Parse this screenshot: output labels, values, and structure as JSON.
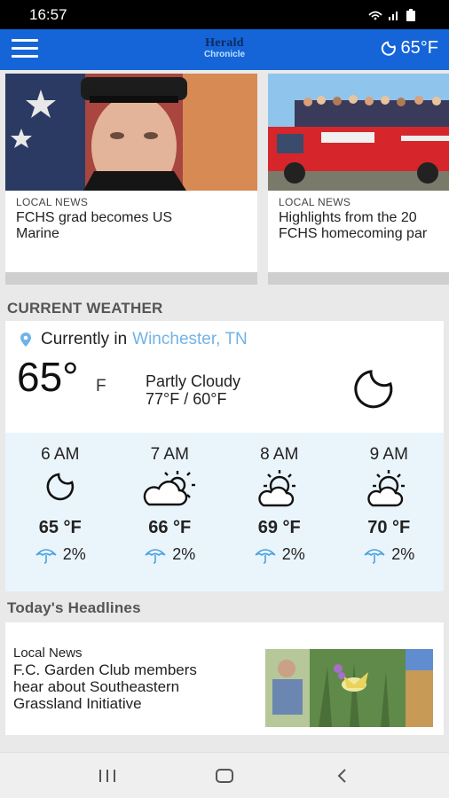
{
  "status_bar": {
    "time": "16:57"
  },
  "app_bar": {
    "logo_line1": "Herald",
    "logo_line2": "Chronicle",
    "temperature": "65°F"
  },
  "top_stories": [
    {
      "kicker": "LOCAL NEWS",
      "title": "FCHS grad becomes US\nMarine"
    },
    {
      "kicker": "LOCAL NEWS",
      "title": "Highlights from the 20\nFCHS homecoming par"
    }
  ],
  "weather": {
    "section_title": "CURRENT WEATHER",
    "currently_label": "Currently in",
    "city": "Winchester, TN",
    "temp": "65°",
    "unit": "F",
    "condition": "Partly Cloudy",
    "hi_lo": "77°F / 60°F",
    "condition_icon": "moon-icon",
    "hourly": [
      {
        "time": "6 AM",
        "icon": "moon-icon",
        "temp": "65 °F",
        "precip": "2%"
      },
      {
        "time": "7 AM",
        "icon": "cloud-sun-icon",
        "temp": "66 °F",
        "precip": "2%"
      },
      {
        "time": "8 AM",
        "icon": "partly-sunny-icon",
        "temp": "69 °F",
        "precip": "2%"
      },
      {
        "time": "9 AM",
        "icon": "partly-sunny-icon",
        "temp": "70 °F",
        "precip": "2%"
      }
    ]
  },
  "headlines": {
    "section_title": "Today's Headlines",
    "items": [
      {
        "kicker": "Local News",
        "title": "F.C. Garden Club members\nhear about Southeastern\nGrassland Initiative"
      }
    ]
  },
  "colors": {
    "app_bar": "#1565d8",
    "link": "#6fb3e8",
    "hourly_bg": "#eaf4fb"
  }
}
